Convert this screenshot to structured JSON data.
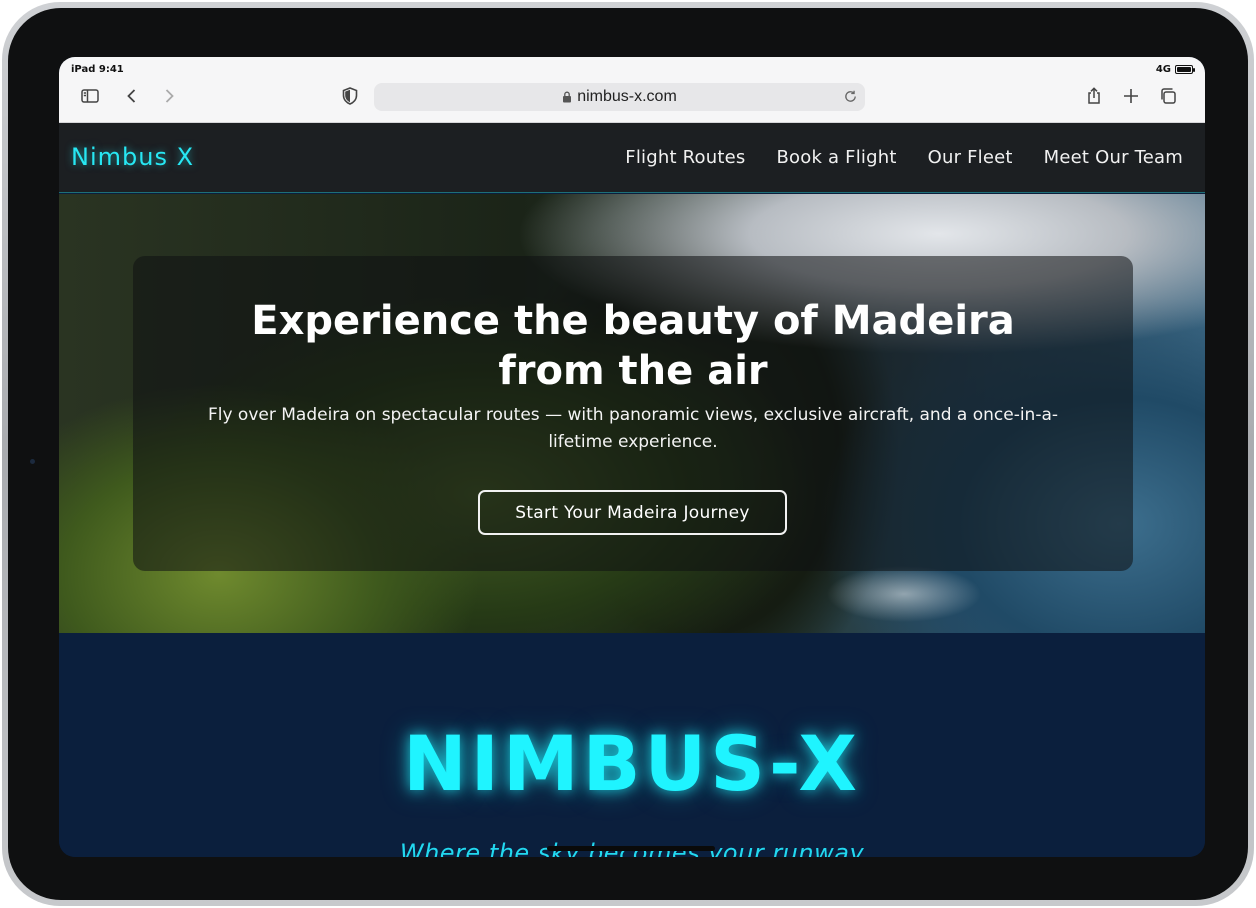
{
  "status_bar": {
    "time": "iPad 9:41",
    "network": "4G",
    "battery_level": 1.0
  },
  "browser": {
    "url": "nimbus-x.com",
    "icons": {
      "sidebar": "sidebar-icon",
      "back": "chevron-left-icon",
      "forward": "chevron-right-icon",
      "privacy": "shield-icon",
      "lock": "lock-icon",
      "reload": "reload-icon",
      "share": "share-icon",
      "new_tab": "plus-icon",
      "tabs": "tabs-icon"
    }
  },
  "nav": {
    "brand": "Nimbus X",
    "links": [
      {
        "label": "Flight Routes"
      },
      {
        "label": "Book a Flight"
      },
      {
        "label": "Our Fleet"
      },
      {
        "label": "Meet Our Team"
      }
    ]
  },
  "hero": {
    "title": "Experience the beauty of Madeira from the air",
    "subtitle": "Fly over Madeira on spectacular routes — with panoramic views, exclusive aircraft, and a once-in-a-lifetime experience.",
    "cta_label": "Start Your Madeira Journey"
  },
  "brand_section": {
    "heading": "NIMBUS-X",
    "tagline": "Where the sky becomes your runway"
  },
  "colors": {
    "accent": "#27e7f3",
    "nav_background": "#1c1f22",
    "section_background": "#0b1f3d"
  }
}
